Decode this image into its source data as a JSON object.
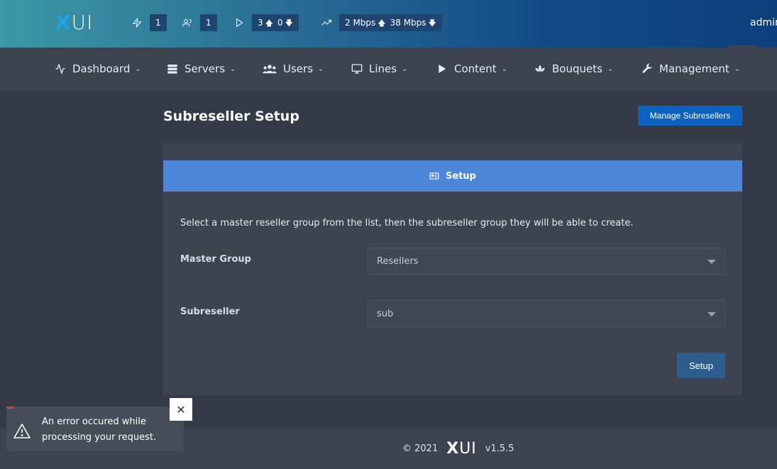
{
  "brand": {
    "logo_x": "X",
    "logo_ui": "UI"
  },
  "topbar": {
    "stats": [
      {
        "icon": "bolt-icon",
        "value": "1"
      },
      {
        "icon": "users-icon",
        "value": "1"
      },
      {
        "icon": "play-icon",
        "up_value": "3",
        "down_value": "0"
      },
      {
        "icon": "trending-icon",
        "up_value": "2 Mbps",
        "down_value": "38 Mbps"
      }
    ],
    "user": "admin"
  },
  "nav": {
    "items": [
      {
        "label": "Dashboard",
        "icon": "activity-icon"
      },
      {
        "label": "Servers",
        "icon": "server-icon"
      },
      {
        "label": "Users",
        "icon": "users-icon"
      },
      {
        "label": "Lines",
        "icon": "monitor-icon"
      },
      {
        "label": "Content",
        "icon": "play-icon"
      },
      {
        "label": "Bouquets",
        "icon": "lotus-icon"
      },
      {
        "label": "Management",
        "icon": "wrench-icon"
      }
    ]
  },
  "page": {
    "title": "Subreseller Setup",
    "manage_button": "Manage Subresellers",
    "card_header": "Setup",
    "description": "Select a master reseller group from the list, then the subreseller group they will be able to create.",
    "fields": [
      {
        "label": "Master Group",
        "value": "Resellers"
      },
      {
        "label": "Subreseller",
        "value": "sub"
      }
    ],
    "submit_button": "Setup"
  },
  "footer": {
    "copyright": "© 2021",
    "logo_x": "X",
    "logo_ui": "UI",
    "version": "v1.5.5"
  },
  "toast": {
    "message": "An error occured while processing your request.",
    "close": "✕"
  },
  "colors": {
    "accent": "#4e86da",
    "brand_blue": "#0d62c1",
    "error": "#e03a3a"
  }
}
